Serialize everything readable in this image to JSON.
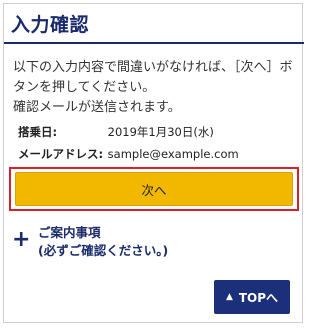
{
  "header": {
    "title": "入力確認"
  },
  "intro": {
    "line1": "以下の入力内容で間違いがなければ、［次へ］ボ",
    "line2": "タンを押してください。",
    "line3": "確認メールが送信されます。"
  },
  "fields": [
    {
      "label": "搭乗日:",
      "value": "2019年1月30日(水)"
    },
    {
      "label": "メールアドレス:",
      "value": "sample@example.com"
    }
  ],
  "next_button": {
    "label": "次へ"
  },
  "notice": {
    "line1": "ご案内事項",
    "line2": "(必ずご確認ください。)"
  },
  "top_button": {
    "label": "TOPへ",
    "icon": "home-icon"
  },
  "colors": {
    "accent": "#f2b800",
    "navy": "#1a2b6b",
    "highlight": "#d8202a"
  }
}
